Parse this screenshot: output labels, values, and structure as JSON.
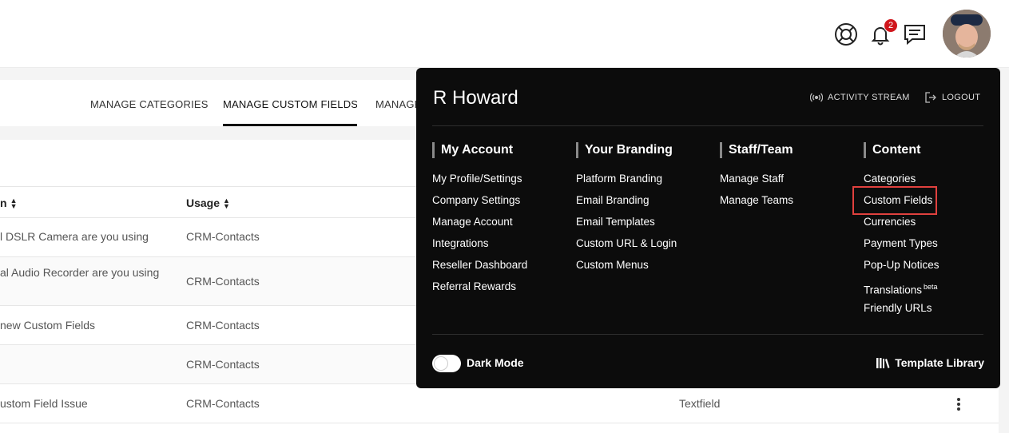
{
  "header": {
    "notification_count": "2",
    "icons": [
      "lifebuoy-icon",
      "bell-icon",
      "chat-icon",
      "avatar"
    ]
  },
  "tabs": [
    {
      "label": "MANAGE CATEGORIES"
    },
    {
      "label": "MANAGE CUSTOM FIELDS",
      "active": true
    },
    {
      "label": "MANAGE"
    }
  ],
  "table": {
    "headers": {
      "col1": "n",
      "col2": "Usage"
    },
    "rows": [
      {
        "name": "l DSLR Camera are you using",
        "name2": "",
        "usage": "CRM-Contacts",
        "type": ""
      },
      {
        "name": "al Audio Recorder are you using",
        "name2": "",
        "usage": "CRM-Contacts",
        "type": ""
      },
      {
        "name": "new Custom Fields",
        "name2": "",
        "usage": "CRM-Contacts",
        "type": ""
      },
      {
        "name": "",
        "name2": "",
        "usage": "CRM-Contacts",
        "type": ""
      },
      {
        "name": "ustom Field Issue",
        "name2": "",
        "usage": "CRM-Contacts",
        "type": "Textfield"
      }
    ]
  },
  "menu": {
    "user_name": "R Howard",
    "activity_stream": "ACTIVITY STREAM",
    "logout": "LOGOUT",
    "columns": [
      {
        "title": "My Account",
        "items": [
          "My Profile/Settings",
          "Company Settings",
          "Manage Account",
          "Integrations",
          "Reseller Dashboard",
          "Referral Rewards"
        ]
      },
      {
        "title": "Your Branding",
        "items": [
          "Platform Branding",
          "Email Branding",
          "Email Templates",
          "Custom URL & Login",
          "Custom Menus"
        ]
      },
      {
        "title": "Staff/Team",
        "items": [
          "Manage Staff",
          "Manage Teams"
        ]
      },
      {
        "title": "Content",
        "items": [
          "Categories",
          "Custom Fields",
          "Currencies",
          "Payment Types",
          "Pop-Up Notices",
          "Translations",
          "Friendly URLs"
        ]
      }
    ],
    "translations_sup": "beta",
    "dark_mode": "Dark Mode",
    "template_library": "Template Library",
    "highlight_color": "#e0413e"
  }
}
